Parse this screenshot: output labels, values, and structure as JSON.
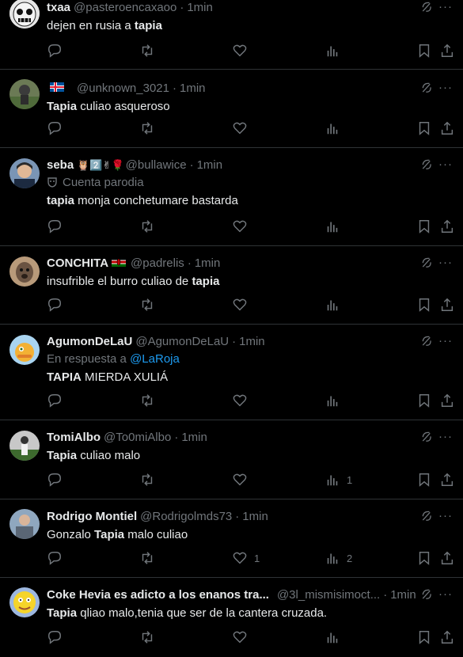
{
  "tweets": [
    {
      "name": "txaa",
      "handle": "@pasteroencaxaoo",
      "time": "1min",
      "text_pre": "dejen en rusia a ",
      "text_bold": "tapia",
      "text_post": "",
      "reply_count": "",
      "retweet_count": "",
      "like_count": "",
      "view_count": ""
    },
    {
      "name": "",
      "flag": "iceland-flag",
      "handle": "@unknown_3021",
      "time": "1min",
      "text_pre": "",
      "text_bold": "Tapia",
      "text_post": " culiao asqueroso",
      "reply_count": "",
      "retweet_count": "",
      "like_count": "",
      "view_count": ""
    },
    {
      "name": "seba",
      "name_emojis": "🦉2️⃣✌🌹",
      "handle": "@bullawice",
      "time": "1min",
      "parody_label": "Cuenta parodia",
      "text_pre": "",
      "text_bold": "tapia",
      "text_post": " monja conchetumare bastarda",
      "reply_count": "",
      "retweet_count": "",
      "like_count": "",
      "view_count": ""
    },
    {
      "name": "CONCHITA",
      "flag": "kenya-flag",
      "handle": "@padrelis",
      "time": "1min",
      "text_pre": "insufrible el burro culiao de ",
      "text_bold": "tapia",
      "text_post": "",
      "reply_count": "",
      "retweet_count": "",
      "like_count": "",
      "view_count": ""
    },
    {
      "name": "AgumonDeLaU",
      "handle": "@AgumonDeLaU",
      "time": "1min",
      "reply_prefix": "En respuesta a ",
      "reply_to": "@LaRoja",
      "text_pre": "",
      "text_bold": "TAPIA",
      "text_post": " MIERDA XULIÁ",
      "reply_count": "",
      "retweet_count": "",
      "like_count": "",
      "view_count": ""
    },
    {
      "name": "TomiAlbo",
      "handle": "@To0miAlbo",
      "time": "1min",
      "text_pre": "",
      "text_bold": "Tapia",
      "text_post": " culiao malo",
      "reply_count": "",
      "retweet_count": "",
      "like_count": "",
      "view_count": "1"
    },
    {
      "name": "Rodrigo Montiel",
      "handle": "@Rodrigolmds73",
      "time": "1min",
      "text_pre": "Gonzalo ",
      "text_bold": "Tapia",
      "text_post": " malo culiao",
      "reply_count": "",
      "retweet_count": "",
      "like_count": "1",
      "view_count": "2"
    },
    {
      "name": "Coke Hevia es adicto a los enanos tra...",
      "handle": "@3l_mismisimoct...",
      "time": "1min",
      "text_pre": "",
      "text_bold": "Tapia",
      "text_post": " qliao malo,tenia que ser de la cantera cruzada.",
      "reply_count": "",
      "retweet_count": "",
      "like_count": "",
      "view_count": ""
    }
  ],
  "colors": {
    "background": "#000000",
    "text": "#e7e9ea",
    "muted": "#71767b",
    "link": "#1d9bf0",
    "border": "#2f3336"
  },
  "icons": [
    "reply-icon",
    "retweet-icon",
    "like-icon",
    "views-icon",
    "bookmark-icon",
    "share-icon",
    "grok-icon",
    "more-icon"
  ]
}
